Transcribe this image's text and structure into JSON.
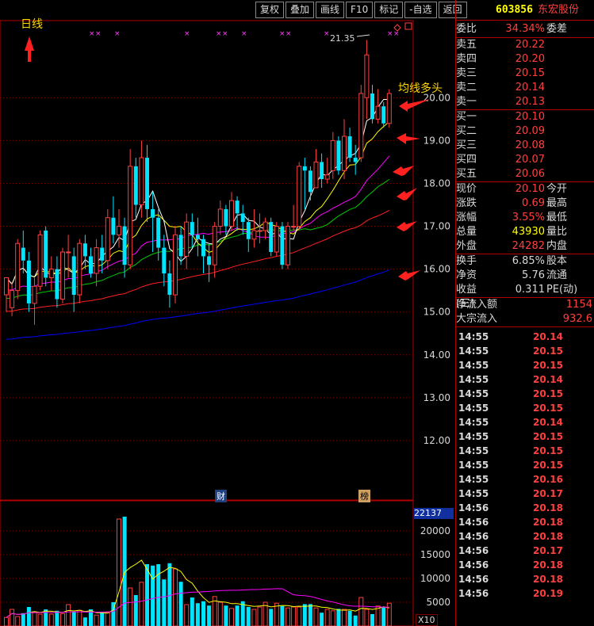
{
  "toolbar": {
    "buttons": [
      "复权",
      "叠加",
      "画线",
      "F10",
      "标记",
      "-自选",
      "返回"
    ]
  },
  "stock": {
    "code": "603856",
    "name": "东宏股份"
  },
  "annotations": {
    "period": "日线",
    "ma_note": "均线多头",
    "high_label": "21.35",
    "fin_badge": "财",
    "rank_badge": "榜"
  },
  "price_axis": {
    "labels": [
      "20.00",
      "19.00",
      "18.00",
      "17.00",
      "16.00",
      "15.00",
      "14.00",
      "13.00",
      "12.00"
    ],
    "ylim": [
      11.0,
      21.8
    ]
  },
  "volume_axis": {
    "labels": [
      "20000",
      "15000",
      "10000",
      "5000"
    ],
    "current": "22137",
    "unit": "X10"
  },
  "quote": {
    "webi": {
      "label": "委比",
      "value": "34.34%",
      "label2": "委差"
    },
    "asks": [
      {
        "label": "卖五",
        "price": "20.22"
      },
      {
        "label": "卖四",
        "price": "20.20"
      },
      {
        "label": "卖三",
        "price": "20.15"
      },
      {
        "label": "卖二",
        "price": "20.14"
      },
      {
        "label": "卖一",
        "price": "20.13"
      }
    ],
    "bids": [
      {
        "label": "买一",
        "price": "20.10"
      },
      {
        "label": "买二",
        "price": "20.09"
      },
      {
        "label": "买三",
        "price": "20.08"
      },
      {
        "label": "买四",
        "price": "20.07"
      },
      {
        "label": "买五",
        "price": "20.06"
      }
    ],
    "stats": [
      {
        "label": "现价",
        "value": "20.10",
        "label2": "今开",
        "color": "red"
      },
      {
        "label": "涨跌",
        "value": "0.69",
        "label2": "最高",
        "color": "red"
      },
      {
        "label": "涨幅",
        "value": "3.55%",
        "label2": "最低",
        "color": "red"
      },
      {
        "label": "总量",
        "value": "43930",
        "label2": "量比",
        "color": "yel"
      },
      {
        "label": "外盘",
        "value": "24282",
        "label2": "内盘",
        "color": "red"
      }
    ],
    "finance": [
      {
        "label": "换手",
        "value": "6.85%",
        "label2": "股本"
      },
      {
        "label": "净资",
        "value": "5.76",
        "label2": "流通"
      },
      {
        "label": "收益(三)",
        "value": "0.311",
        "label2": "PE(动)"
      }
    ],
    "flows": [
      {
        "label": "净流入额",
        "value": "1154"
      },
      {
        "label": "大宗流入",
        "value": "932.6"
      }
    ]
  },
  "ticks": [
    {
      "time": "14:55",
      "price": "20.14"
    },
    {
      "time": "14:55",
      "price": "20.15"
    },
    {
      "time": "14:55",
      "price": "20.15"
    },
    {
      "time": "14:55",
      "price": "20.14"
    },
    {
      "time": "14:55",
      "price": "20.15"
    },
    {
      "time": "14:55",
      "price": "20.15"
    },
    {
      "time": "14:55",
      "price": "20.14"
    },
    {
      "time": "14:55",
      "price": "20.15"
    },
    {
      "time": "14:55",
      "price": "20.15"
    },
    {
      "time": "14:55",
      "price": "20.15"
    },
    {
      "time": "14:55",
      "price": "20.16"
    },
    {
      "time": "14:55",
      "price": "20.17"
    },
    {
      "time": "14:56",
      "price": "20.18"
    },
    {
      "time": "14:56",
      "price": "20.18"
    },
    {
      "time": "14:56",
      "price": "20.18"
    },
    {
      "time": "14:56",
      "price": "20.17"
    },
    {
      "time": "14:56",
      "price": "20.18"
    },
    {
      "time": "14:56",
      "price": "20.18"
    },
    {
      "time": "14:56",
      "price": "20.19"
    }
  ],
  "colors": {
    "up": "#ff4040",
    "down": "#00e5ff",
    "ma5": "#ffffff",
    "ma10": "#ffff00",
    "ma20": "#ff00ff",
    "ma30": "#00cc00",
    "ma60": "#ff2020",
    "ma120": "#0000ff",
    "grid": "#800000"
  },
  "chart_data": {
    "type": "candlestick",
    "ylim": [
      11.0,
      21.8
    ],
    "candles": [
      [
        15.4,
        15.8,
        15.2,
        15.0
      ],
      [
        15.1,
        15.5,
        15.7,
        14.9
      ],
      [
        15.5,
        16.6,
        16.7,
        15.3
      ],
      [
        16.5,
        16.2,
        16.9,
        15.9
      ],
      [
        16.2,
        15.2,
        16.4,
        15.0
      ],
      [
        15.2,
        15.6,
        15.8,
        14.7
      ],
      [
        15.6,
        16.8,
        16.9,
        15.5
      ],
      [
        16.9,
        15.8,
        17.0,
        15.6
      ],
      [
        15.8,
        16.0,
        16.3,
        15.5
      ],
      [
        16.0,
        15.3,
        16.3,
        15.1
      ],
      [
        15.3,
        16.4,
        16.5,
        15.2
      ],
      [
        16.4,
        16.4,
        16.8,
        15.8
      ],
      [
        16.3,
        15.4,
        16.5,
        15.0
      ],
      [
        15.4,
        16.6,
        16.7,
        15.2
      ],
      [
        16.6,
        16.3,
        16.8,
        16.0
      ],
      [
        16.3,
        15.9,
        16.5,
        15.8
      ],
      [
        15.9,
        16.5,
        16.7,
        15.6
      ],
      [
        16.5,
        16.2,
        16.8,
        15.9
      ],
      [
        16.2,
        17.2,
        17.4,
        16.0
      ],
      [
        17.2,
        16.8,
        17.7,
        16.6
      ],
      [
        16.8,
        17.0,
        17.4,
        16.5
      ],
      [
        17.0,
        16.1,
        17.2,
        15.8
      ],
      [
        16.1,
        18.4,
        18.8,
        16.0
      ],
      [
        18.4,
        17.5,
        18.6,
        17.2
      ],
      [
        17.5,
        18.6,
        19.0,
        17.2
      ],
      [
        18.6,
        17.4,
        18.9,
        17.1
      ],
      [
        17.4,
        17.2,
        17.8,
        16.4
      ],
      [
        17.2,
        16.5,
        17.4,
        16.2
      ],
      [
        16.5,
        15.9,
        16.8,
        15.6
      ],
      [
        15.9,
        15.4,
        16.2,
        15.1
      ],
      [
        15.4,
        16.8,
        17.0,
        15.2
      ],
      [
        16.8,
        16.3,
        17.0,
        16.1
      ],
      [
        16.3,
        17.1,
        17.3,
        16.0
      ],
      [
        17.1,
        16.8,
        17.3,
        16.5
      ],
      [
        16.8,
        16.7,
        17.2,
        16.3
      ],
      [
        16.7,
        16.3,
        16.8,
        15.9
      ],
      [
        16.3,
        16.1,
        16.6,
        15.7
      ],
      [
        16.1,
        17.0,
        17.1,
        15.8
      ],
      [
        17.0,
        17.4,
        17.6,
        16.8
      ],
      [
        17.4,
        17.0,
        17.5,
        16.8
      ],
      [
        17.0,
        17.6,
        17.8,
        16.9
      ],
      [
        17.6,
        17.3,
        17.7,
        16.9
      ],
      [
        17.3,
        17.1,
        17.5,
        16.8
      ],
      [
        17.1,
        16.7,
        17.2,
        16.4
      ],
      [
        16.7,
        16.9,
        17.4,
        16.5
      ],
      [
        16.9,
        16.9,
        17.3,
        16.6
      ],
      [
        16.9,
        17.1,
        17.2,
        16.7
      ],
      [
        17.1,
        16.4,
        17.2,
        16.3
      ],
      [
        16.4,
        17.0,
        17.1,
        16.3
      ],
      [
        17.0,
        16.1,
        17.1,
        16.0
      ],
      [
        16.1,
        17.0,
        17.1,
        16.0
      ],
      [
        17.0,
        17.0,
        17.5,
        16.9
      ],
      [
        17.0,
        18.4,
        18.5,
        16.9
      ],
      [
        18.4,
        18.3,
        18.6,
        17.4
      ],
      [
        18.3,
        17.8,
        18.4,
        17.6
      ],
      [
        17.9,
        18.5,
        18.8,
        17.9
      ],
      [
        18.5,
        18.1,
        18.7,
        17.9
      ],
      [
        18.1,
        18.2,
        18.6,
        18.0
      ],
      [
        18.3,
        19.0,
        19.2,
        18.1
      ],
      [
        19.0,
        18.3,
        19.1,
        18.2
      ],
      [
        18.3,
        19.1,
        19.5,
        18.1
      ],
      [
        19.1,
        18.6,
        19.3,
        18.5
      ],
      [
        18.6,
        18.5,
        18.9,
        18.2
      ],
      [
        18.6,
        20.1,
        20.3,
        18.5
      ],
      [
        20.0,
        21.0,
        21.35,
        19.5
      ],
      [
        20.1,
        19.5,
        20.3,
        19.4
      ],
      [
        19.5,
        19.8,
        20.2,
        19.4
      ],
      [
        19.8,
        19.4,
        19.9,
        19.3
      ],
      [
        19.4,
        20.1,
        20.2,
        19.3
      ]
    ],
    "volume": [
      1800,
      3500,
      2000,
      2700,
      4000,
      3000,
      2500,
      3500,
      2500,
      3200,
      2600,
      4500,
      3000,
      3300,
      1800,
      3500,
      2300,
      3000,
      3000,
      5000,
      22500,
      23000,
      8000,
      6500,
      9200,
      13000,
      12700,
      13000,
      9800,
      13200,
      12000,
      9300,
      4500,
      6000,
      4800,
      5200,
      4300,
      6200,
      5000,
      4300,
      3700,
      4300,
      5200,
      4000,
      3500,
      4000,
      5000,
      3600,
      4800,
      4200,
      3800,
      4000,
      4000,
      4600,
      4600,
      3800,
      2800,
      3500,
      3200,
      3600,
      3500,
      3200,
      2200,
      6000,
      3500,
      2500,
      4200,
      4000,
      4800
    ]
  }
}
